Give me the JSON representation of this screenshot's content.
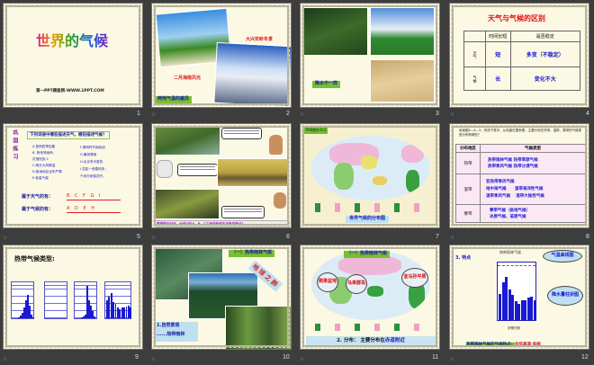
{
  "slide_numbers": [
    "1",
    "2",
    "3",
    "4",
    "5",
    "6",
    "7",
    "8",
    "9",
    "10",
    "11",
    "12"
  ],
  "s1": {
    "title": "世界的气候",
    "subtitle": "第一PPT模板网-WWW.1PPT.COM"
  },
  "s2": {
    "label_winter": "大兴安岭冬景",
    "label_hainan": "二月海南风光",
    "caption": "两地气温的差异"
  },
  "s3": {
    "caption": "降水不一样"
  },
  "s4": {
    "title": "天气与气候的区别",
    "headers": [
      "",
      "时间长短",
      "是否稳定"
    ],
    "rows": [
      [
        "天气",
        "短",
        "多变（不稳定）"
      ],
      [
        "气候",
        "长",
        "变化不大"
      ]
    ]
  },
  "s5": {
    "side": "巩固练习",
    "question": "下列词语中哪些描述天气，哪些描述气候？",
    "left": [
      "A.昆明四季如春",
      "B. 夜来风雨声，",
      "花落知多少",
      "C.明天大风降温",
      "D.极地地区全年严寒",
      "E.秋高气爽"
    ],
    "right": [
      "F.清明时节雨纷纷",
      "G.暴风骤雨",
      "H.北京冬冷夏热",
      "I.忽如一夜春风来，",
      "千树万树梨花开。"
    ],
    "weather_label": "属于天气的有：",
    "weather_answer": "B C F G I",
    "climate_label": "属于气候的有：",
    "climate_answer": "A D E H"
  },
  "s6": {
    "caption": "根据图中对话，分组讨论A、B、C三地的气候各自有何特点?"
  },
  "s7": {
    "tag": "P68图4-4-3",
    "caption": "世界气候的分布图"
  },
  "s8": {
    "intro": "阅读图4—4—3，完成下表中，从纬度位置来看，主要分布在热带、温带、寒带的气候类型分别有哪些？",
    "headers": [
      "分布地区",
      "气候类型"
    ],
    "rows": [
      {
        "zone": "热带",
        "types": [
          "热带雨林气候  热带草原气候",
          "热带季风气候  热带沙漠气候"
        ]
      },
      {
        "zone": "温带",
        "types": [
          "亚热带季风气候",
          "地中海气候      温带海洋性气候",
          "温带季风气候    温带大陆性气候"
        ]
      },
      {
        "zone": "寒带",
        "types": [
          "寒带气候（极地气候）",
          "冰原气候、苔原气候"
        ]
      }
    ]
  },
  "s9": {
    "title": "热带气候类型:"
  },
  "s10": {
    "tag": "（一）热带雨林气候",
    "rotated": "地球之肺",
    "line1": "1.自然景观",
    "line2": "......热带雨林"
  },
  "s11": {
    "tag": "（一）热带雨林气候",
    "clouds": [
      "刚果盆地",
      "马来群岛",
      "亚马孙平原"
    ],
    "bottom_prefix": "2. 分布：  主要分布在",
    "bottom_highlight": "赤道附近"
  },
  "s12": {
    "heading": "3. 特点",
    "chart_title": "热带雨林气候",
    "station": "伊基托斯",
    "cloud_temp": "气温曲线图",
    "cloud_prec": "降水量柱状图",
    "precip_mm": [
      270,
      390,
      450,
      315,
      265,
      200,
      165,
      210,
      205,
      235,
      240,
      210
    ],
    "bottom_prefix": "热带雨林气候的气候特点：",
    "bottom_highlight": "全年高温 多雨"
  }
}
